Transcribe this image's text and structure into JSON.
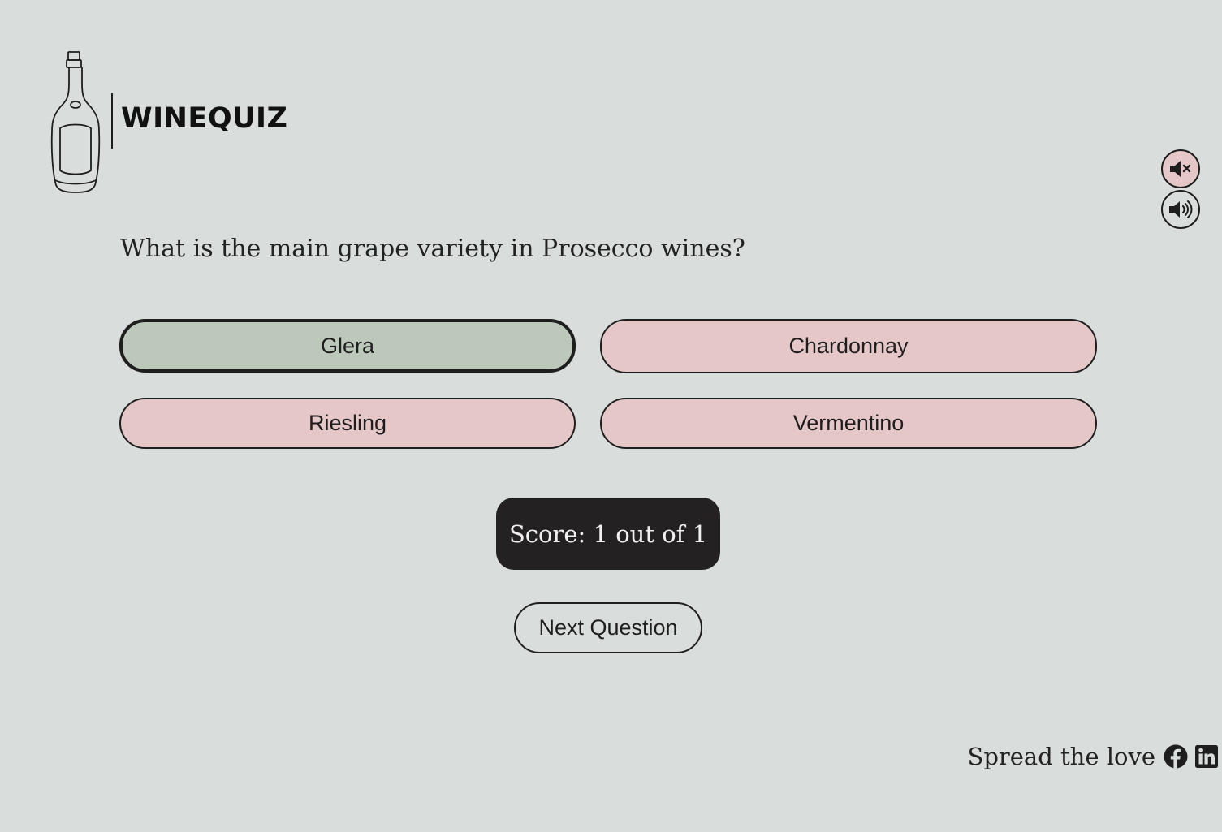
{
  "brand": {
    "logo_text": "WINEQUIZ"
  },
  "quiz": {
    "question": "What is the main grape variety in Prosecco wines?",
    "answers": [
      {
        "label": "Glera",
        "state": "correct"
      },
      {
        "label": "Chardonnay",
        "state": "default"
      },
      {
        "label": "Riesling",
        "state": "default"
      },
      {
        "label": "Vermentino",
        "state": "default"
      }
    ],
    "score_text": "Score: 1 out of 1",
    "next_label": "Next Question"
  },
  "sound": {
    "mute_icon": "volume-mute-icon",
    "unmute_icon": "volume-up-icon",
    "active": "mute"
  },
  "footer": {
    "share_text": "Spread the love",
    "social": [
      {
        "name": "facebook-icon"
      },
      {
        "name": "linkedin-icon"
      }
    ]
  },
  "colors": {
    "background": "#d9dddc",
    "answer_default": "#e6c7c8",
    "answer_correct": "#bcc8b9",
    "score_bg": "#232122",
    "ink": "#1f1e1f"
  }
}
